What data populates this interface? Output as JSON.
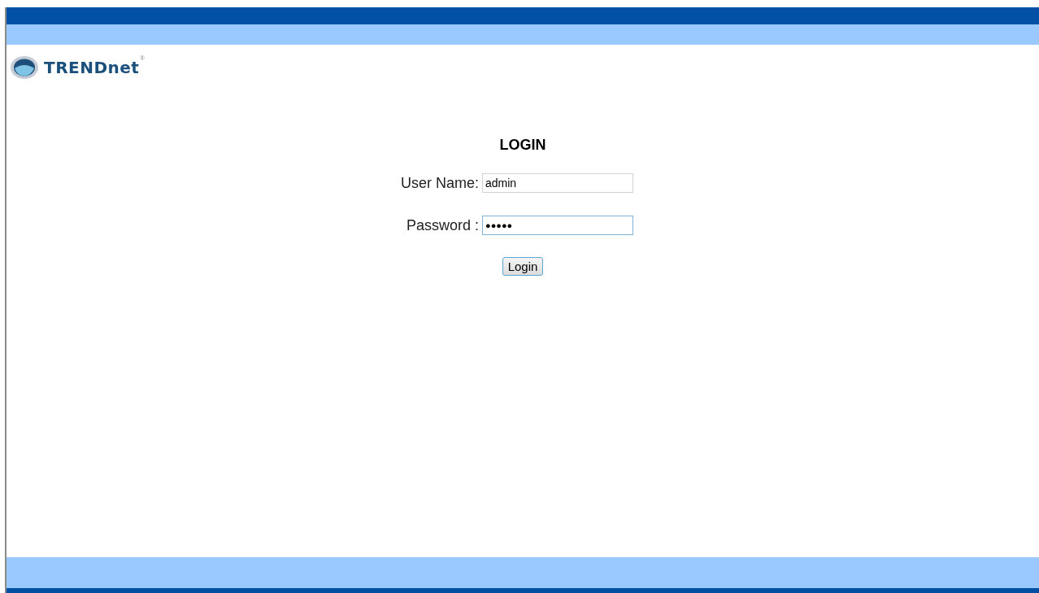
{
  "logo": {
    "brand": "TRENDnet",
    "mark": "®"
  },
  "login": {
    "title": "LOGIN",
    "fields": [
      {
        "label": "User Name:",
        "value": "admin",
        "kind": "text",
        "focused": false
      },
      {
        "label": "Password :",
        "value": "●●●●●",
        "kind": "password",
        "focused": true
      }
    ],
    "button": "Login"
  }
}
